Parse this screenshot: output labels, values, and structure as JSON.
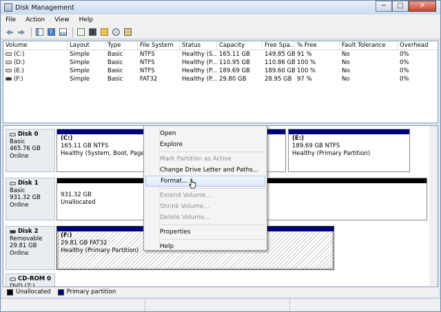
{
  "window": {
    "title": "Disk Management",
    "minimize": "─",
    "maximize": "□",
    "close": "✕"
  },
  "menu": [
    "File",
    "Action",
    "View",
    "Help"
  ],
  "toolbar_icons": [
    "back-arrow-icon",
    "forward-arrow-icon",
    "console-tree-icon",
    "help-icon",
    "properties-icon",
    "refresh-icon",
    "rescan-icon",
    "open-folder-icon",
    "search-icon",
    "settings-icon"
  ],
  "volumes": {
    "columns": [
      "Volume",
      "Layout",
      "Type",
      "File System",
      "Status",
      "Capacity",
      "Free Spa...",
      "% Free",
      "Fault Tolerance",
      "Overhead"
    ],
    "rows": [
      [
        "(C:)",
        "Simple",
        "Basic",
        "NTFS",
        "Healthy (S...",
        "165.11 GB",
        "149.85 GB",
        "91 %",
        "No",
        "0%"
      ],
      [
        "(D:)",
        "Simple",
        "Basic",
        "NTFS",
        "Healthy (P...",
        "110.95 GB",
        "110.86 GB",
        "100 %",
        "No",
        "0%"
      ],
      [
        "(E:)",
        "Simple",
        "Basic",
        "NTFS",
        "Healthy (P...",
        "189.69 GB",
        "189.60 GB",
        "100 %",
        "No",
        "0%"
      ],
      [
        "(F:)",
        "Simple",
        "Basic",
        "FAT32",
        "Healthy (P...",
        "29.80 GB",
        "28.95 GB",
        "97 %",
        "No",
        "0%"
      ]
    ]
  },
  "disks": [
    {
      "name": "Disk 0",
      "type": "Basic",
      "size": "465.76 GB",
      "status": "Online"
    },
    {
      "name": "Disk 1",
      "type": "Basic",
      "size": "931.32 GB",
      "status": "Online"
    },
    {
      "name": "Disk 2",
      "type": "Removable",
      "size": "29.81 GB",
      "status": "Online"
    },
    {
      "name": "CD-ROM 0",
      "type": "DVD (Z:)"
    }
  ],
  "partitions": {
    "c": {
      "label": "(C:)",
      "size": "165.11 GB NTFS",
      "status": "Healthy (System, Boot, Page File,"
    },
    "e": {
      "label": "(E:)",
      "size": "189.69 GB NTFS",
      "status": "Healthy (Primary Partition)"
    },
    "disk1": {
      "size": "931.32 GB",
      "status": "Unallocated"
    },
    "f": {
      "label": "(F:)",
      "size": "29.81 GB FAT32",
      "status": "Healthy (Primary Partition)"
    }
  },
  "legend": {
    "unallocated": "Unallocated",
    "primary": "Primary partition"
  },
  "colors": {
    "primary_partition": "#00007a",
    "unallocated": "#000000"
  },
  "context_menu": {
    "open": "Open",
    "explore": "Explore",
    "mark_active": "Mark Partition as Active",
    "change_letter": "Change Drive Letter and Paths...",
    "format": "Format...",
    "extend": "Extend Volume...",
    "shrink": "Shrink Volume...",
    "delete": "Delete Volume...",
    "properties": "Properties",
    "help": "Help"
  }
}
